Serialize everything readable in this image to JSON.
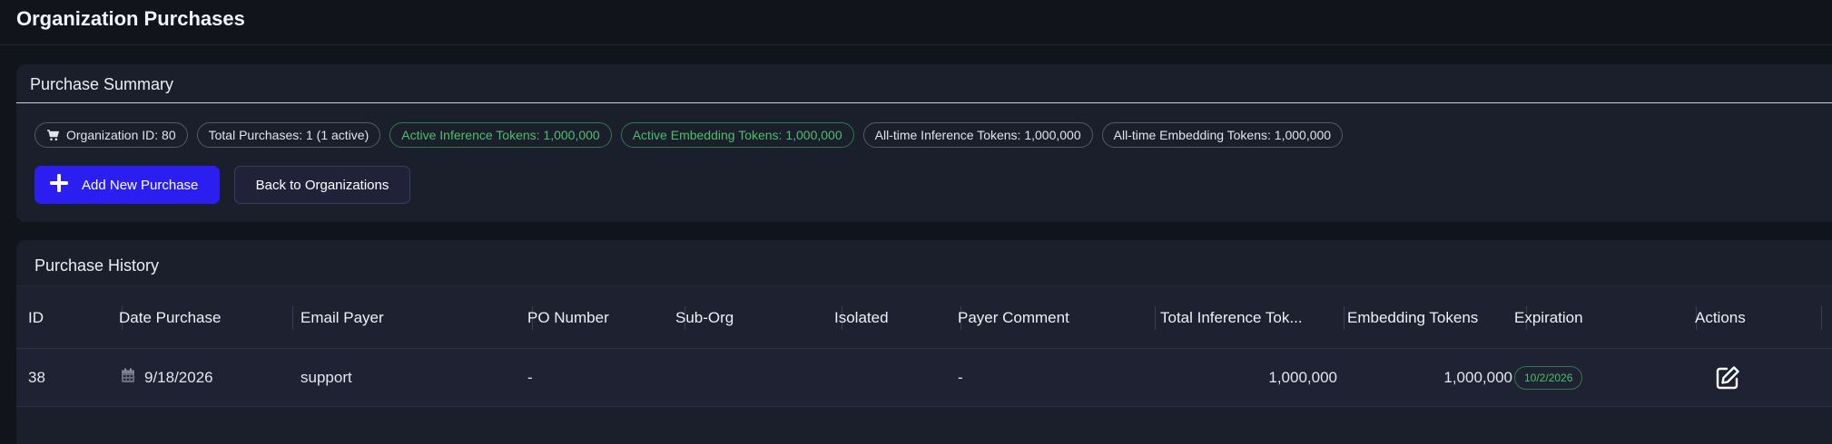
{
  "page": {
    "title": "Organization Purchases"
  },
  "summary": {
    "title": "Purchase Summary",
    "chips": {
      "org_id": "Organization ID: 80",
      "total_purchases": "Total Purchases: 1 (1 active)",
      "active_inference": "Active Inference Tokens: 1,000,000",
      "active_embedding": "Active Embedding Tokens: 1,000,000",
      "alltime_inference": "All-time Inference Tokens: 1,000,000",
      "alltime_embedding": "All-time Embedding Tokens: 1,000,000"
    },
    "buttons": {
      "add_new": "Add New Purchase",
      "back": "Back to Organizations"
    }
  },
  "history": {
    "title": "Purchase History",
    "columns": {
      "id": "ID",
      "date": "Date Purchase",
      "email": "Email Payer",
      "po": "PO Number",
      "suborg": "Sub-Org",
      "isolated": "Isolated",
      "comment": "Payer Comment",
      "total_inference": "Total Inference Tok...",
      "embedding": "Embedding Tokens",
      "expiration": "Expiration",
      "actions": "Actions"
    },
    "rows": [
      {
        "id": "38",
        "date": "9/18/2026",
        "email": "support",
        "po": "-",
        "suborg": "",
        "isolated": "",
        "comment": "-",
        "total_inference": "1,000,000",
        "embedding": "1,000,000",
        "expiration": "10/2/2026"
      }
    ]
  },
  "icons": {
    "cart": "cart-icon",
    "plus": "plus-icon",
    "calendar": "calendar-icon",
    "edit": "edit-icon"
  },
  "colors": {
    "background": "#12141c",
    "card": "#1b1e2b",
    "primary": "#2a1ff0",
    "active_green": "#4fbf6c"
  }
}
